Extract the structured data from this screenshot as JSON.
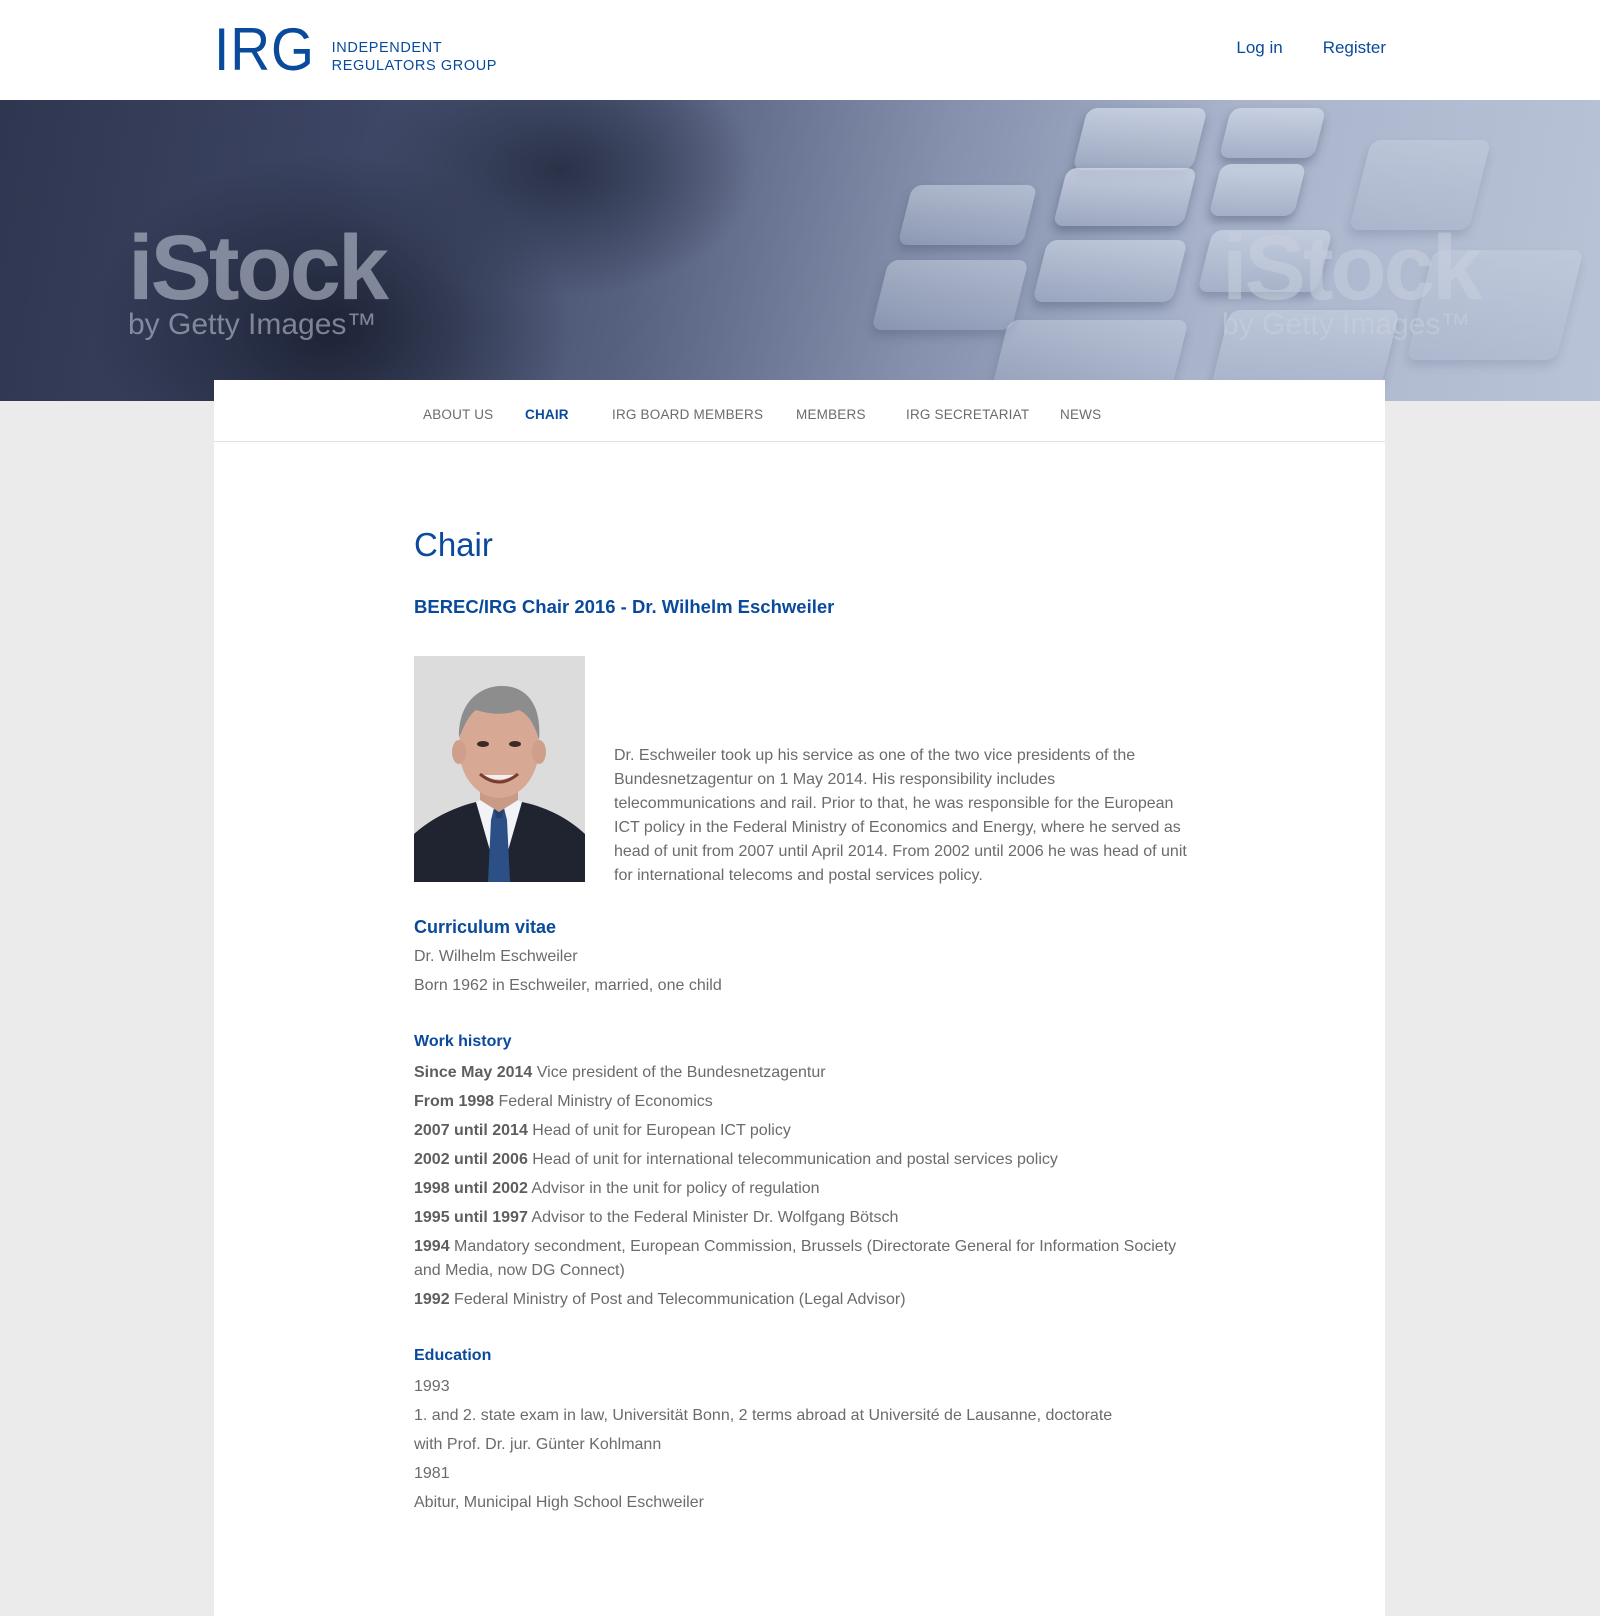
{
  "header": {
    "logo": {
      "mark": "IRG",
      "line1": "Independent",
      "line2": "Regulators Group"
    },
    "login_label": "Log in",
    "register_label": "Register"
  },
  "hero": {
    "watermark_left": {
      "big": "iStock",
      "small": "by Getty Images™"
    },
    "watermark_right": {
      "big": "iStock",
      "small": "by Getty Images™"
    }
  },
  "nav": {
    "items": [
      {
        "label": "About us",
        "active": false
      },
      {
        "label": "Chair",
        "active": true
      },
      {
        "label": "IRG Board Members",
        "active": false
      },
      {
        "label": "Members",
        "active": false
      },
      {
        "label": "IRG Secretariat",
        "active": false
      },
      {
        "label": "News",
        "active": false
      }
    ]
  },
  "main": {
    "title": "Chair",
    "subtitle": "BEREC/IRG Chair 2016 - Dr. Wilhelm Eschweiler",
    "bio": "Dr. Eschweiler took up his service as one of the two vice presidents of the Bundesnetzagentur on 1 May 2014. His responsibility includes telecommunications and rail. Prior to that, he was responsible for the European ICT policy in the Federal Ministry of Economics and Energy, where he served as head of unit from 2007 until April 2014. From 2002 until 2006 he was head of unit for international telecoms and postal services policy.",
    "cv": {
      "heading": "Curriculum vitae",
      "name": "Dr. Wilhelm Eschweiler",
      "born": "Born 1962 in Eschweiler, married, one child"
    },
    "work_history": {
      "heading": "Work history",
      "entries": [
        {
          "period": "Since May 2014",
          "text": "Vice president of the Bundesnetzagentur"
        },
        {
          "period": "From 1998",
          "text": "Federal Ministry of Economics"
        },
        {
          "period": "2007 until 2014",
          "text": "Head of unit for European ICT policy"
        },
        {
          "period": "2002 until 2006",
          "text": "Head of unit for international telecommunication and postal services policy"
        },
        {
          "period": "1998 until 2002",
          "text": "Advisor in the unit for policy of regulation"
        },
        {
          "period": "1995 until 1997",
          "text": "Advisor to the Federal Minister Dr. Wolfgang Bötsch"
        },
        {
          "period": "1994",
          "text": "Mandatory secondment, European Commission, Brussels (Directorate General for Information Society and Media, now DG Connect)"
        },
        {
          "period": "1992",
          "text": "Federal Ministry of Post and Telecommunication (Legal Advisor)"
        }
      ]
    },
    "education": {
      "heading": "Education",
      "year1": "1993",
      "item1_line1": "1. and 2. state exam in law, Universität Bonn, 2 terms abroad at Université de Lausanne, doctorate",
      "item1_line2": "with Prof. Dr. jur. Günter Kohlmann",
      "year2": "1981",
      "item2": "Abitur, Municipal High School Eschweiler"
    }
  },
  "colors": {
    "brand_blue": "#0a4a9c",
    "body_text": "#6b6b6b",
    "page_background": "#ebebeb"
  }
}
